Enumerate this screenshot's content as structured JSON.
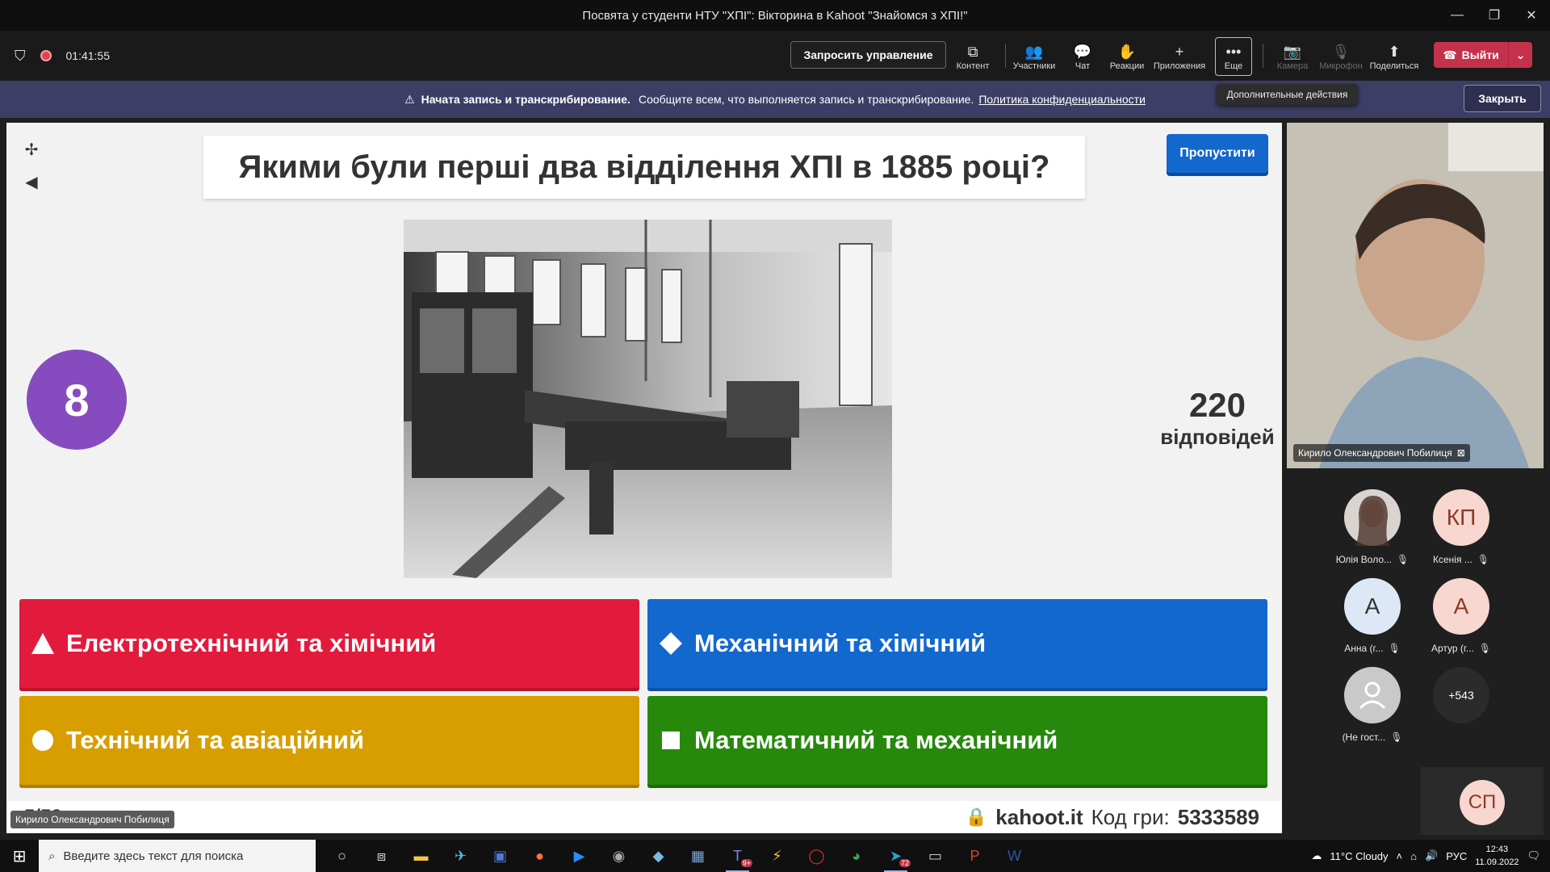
{
  "window": {
    "title": "Посвята у студенти НТУ \"ХПІ\": Вікторина в Kahoot \"Знайомся з ХПІ!\"",
    "minimize_icon": "minimize-icon",
    "restore_icon": "restore-icon",
    "close_icon": "close-icon"
  },
  "toolbar": {
    "timer": "01:41:55",
    "request_control": "Запросить управление",
    "items": {
      "content": "Контент",
      "participants": "Участники",
      "chat": "Чат",
      "reactions": "Реакции",
      "apps": "Приложения",
      "more": "Еще",
      "camera": "Камера",
      "mic": "Микрофон",
      "share": "Поделиться"
    },
    "leave": "Выйти"
  },
  "banner": {
    "bold": "Начата запись и транскрибирование.",
    "text": "Сообщите всем, что выполняется запись и транскрибирование.",
    "link": "Политика конфиденциальности",
    "close": "Закрыть",
    "tooltip": "Дополнительные действия"
  },
  "kahoot": {
    "question": "Якими були перші два відділення ХПІ в 1885 році?",
    "skip": "Пропустити",
    "countdown": "8",
    "answers_count": "220",
    "answers_label": "відповідей",
    "answers": [
      "Електротехнічний та хімічний",
      "Механічний та хімічний",
      "Технічний та авіаційний",
      "Математичний та механічний"
    ],
    "progress": "5/50",
    "brand": "kahoot.it",
    "pin_label": "Код гри:",
    "pin": "5333589",
    "colors": {
      "red": "#e21b3c",
      "blue": "#1368ce",
      "yellow": "#d89e00",
      "green": "#26890c",
      "purple": "#864cbf"
    }
  },
  "presenter_tag": "Кирило Олександрович Побилиця",
  "video": {
    "label": "Кирило Олександрович Побилиця"
  },
  "participants": [
    {
      "initials": "",
      "name": "Юлія Воло...",
      "kind": "photo"
    },
    {
      "initials": "КП",
      "name": "Ксенія ...",
      "kind": "peach"
    },
    {
      "initials": "А",
      "name": "Анна (г...",
      "kind": "blue"
    },
    {
      "initials": "А",
      "name": "Артур (г...",
      "kind": "peach"
    },
    {
      "initials": "",
      "name": "(Не гост...",
      "kind": "gray"
    },
    {
      "initials": "+543",
      "name": "",
      "kind": "dark"
    }
  ],
  "self_tile": {
    "initials": "СП"
  },
  "taskbar": {
    "search_placeholder": "Введите здесь текст для поиска",
    "weather": "11°C  Cloudy",
    "lang": "РУС",
    "time": "12:43",
    "date": "11.09.2022",
    "badge_teams": "9+",
    "badge_telegram": "72"
  }
}
